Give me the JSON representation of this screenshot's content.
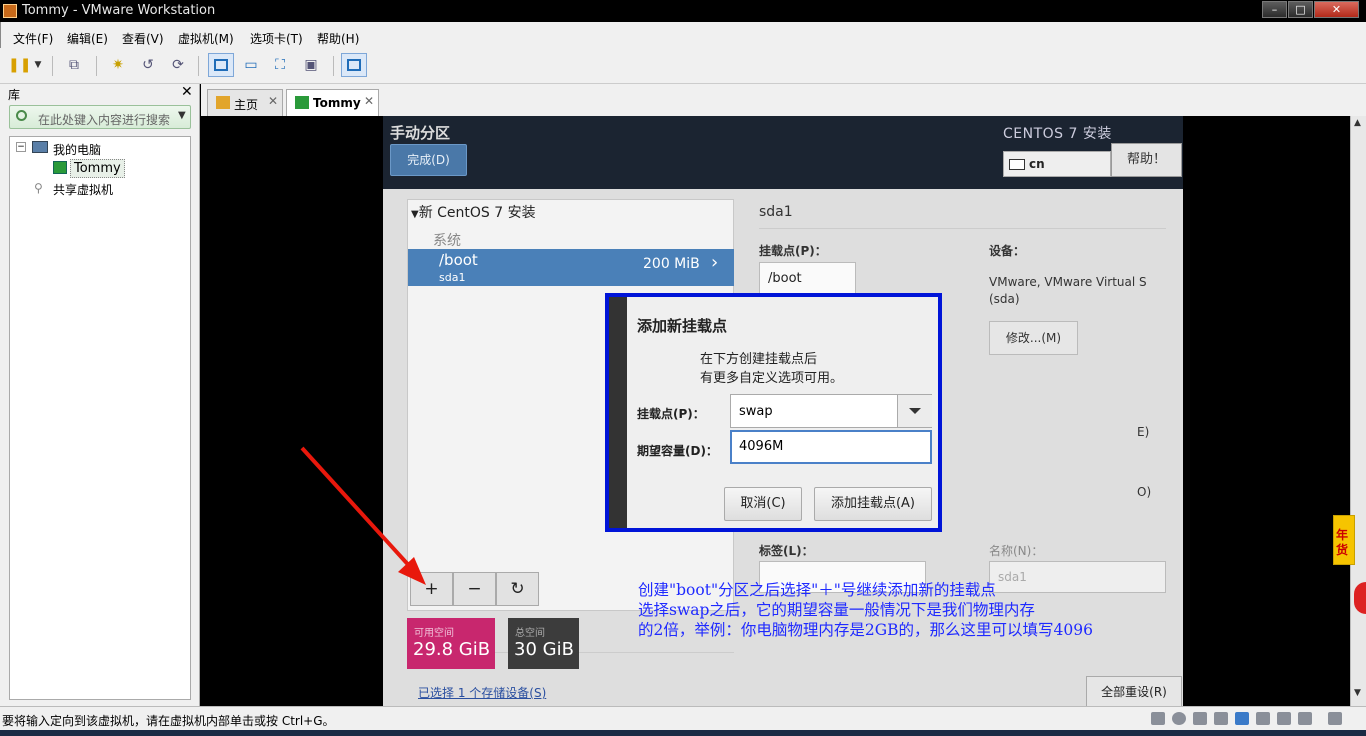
{
  "window": {
    "title": "Tommy - VMware Workstation",
    "minimize": "–",
    "maximize": "□",
    "close": "✕"
  },
  "menu": [
    "文件(F)",
    "编辑(E)",
    "查看(V)",
    "虚拟机(M)",
    "选项卡(T)",
    "帮助(H)"
  ],
  "library": {
    "title": "库",
    "close": "✕",
    "search_placeholder": "在此处键入内容进行搜索",
    "tree": {
      "my_computer": "我的电脑",
      "vm": "Tommy",
      "shared": "共享虚拟机"
    }
  },
  "tabs": [
    {
      "label": "主页",
      "close": "✕"
    },
    {
      "label": "Tommy",
      "close": "✕"
    }
  ],
  "installer": {
    "title": "手动分区",
    "done_label": "完成(D)",
    "product_title": "CENTOS 7 安装",
    "keyboard": "cn",
    "help_label": "帮助！",
    "tree_header": "新 CentOS 7 安装",
    "group_label": "系统",
    "selected_partition": {
      "name": "/boot",
      "device": "sda1",
      "size": "200 MiB"
    },
    "add_btn": "+",
    "remove_btn": "−",
    "refresh_btn": "↻",
    "available": {
      "label": "可用空间",
      "value": "29.8 GiB",
      "color": "#c8276e"
    },
    "total": {
      "label": "总空间",
      "value": "30 GiB",
      "color": "#3c3c3c"
    },
    "selected_devices": "已选择 1 个存储设备(S)",
    "reset_all": "全部重设(R)",
    "right": {
      "section_title": "sda1",
      "mount_label": "挂载点(P)：",
      "mount_value": "/boot",
      "device_label": "设备：",
      "device_value_line1": "VMware, VMware Virtual S",
      "device_value_line2": "(sda)",
      "modify_btn": "修改...(M)",
      "partial1": "E)",
      "partial2": "O)",
      "tag_label": "标签(L)：",
      "name_label": "名称(N)：",
      "name_value": "sda1"
    }
  },
  "dialog": {
    "title": "添加新挂载点",
    "desc_line1": "在下方创建挂载点后",
    "desc_line2": "有更多自定义选项可用。",
    "mount_label": "挂载点(P)：",
    "mount_value": "swap",
    "capacity_label": "期望容量(D)：",
    "capacity_value": "4096M",
    "cancel": "取消(C)",
    "add": "添加挂载点(A)",
    "frame_color": "#0014d8"
  },
  "annotation": {
    "line1": "创建\"boot\"分区之后选择\"＋\"号继续添加新的挂载点",
    "line2": "选择swap之后，它的期望容量一般情况下是我们物理内存",
    "line3": "的2倍，举例：你电脑物理内存是2GB的，那么这里可以填写4096",
    "color": "#1f2aff",
    "arrow_color": "#e8180c"
  },
  "side_badge": "年货",
  "status": {
    "text": "要将输入定向到该虚拟机，请在虚拟机内部单击或按 Ctrl+G。"
  }
}
